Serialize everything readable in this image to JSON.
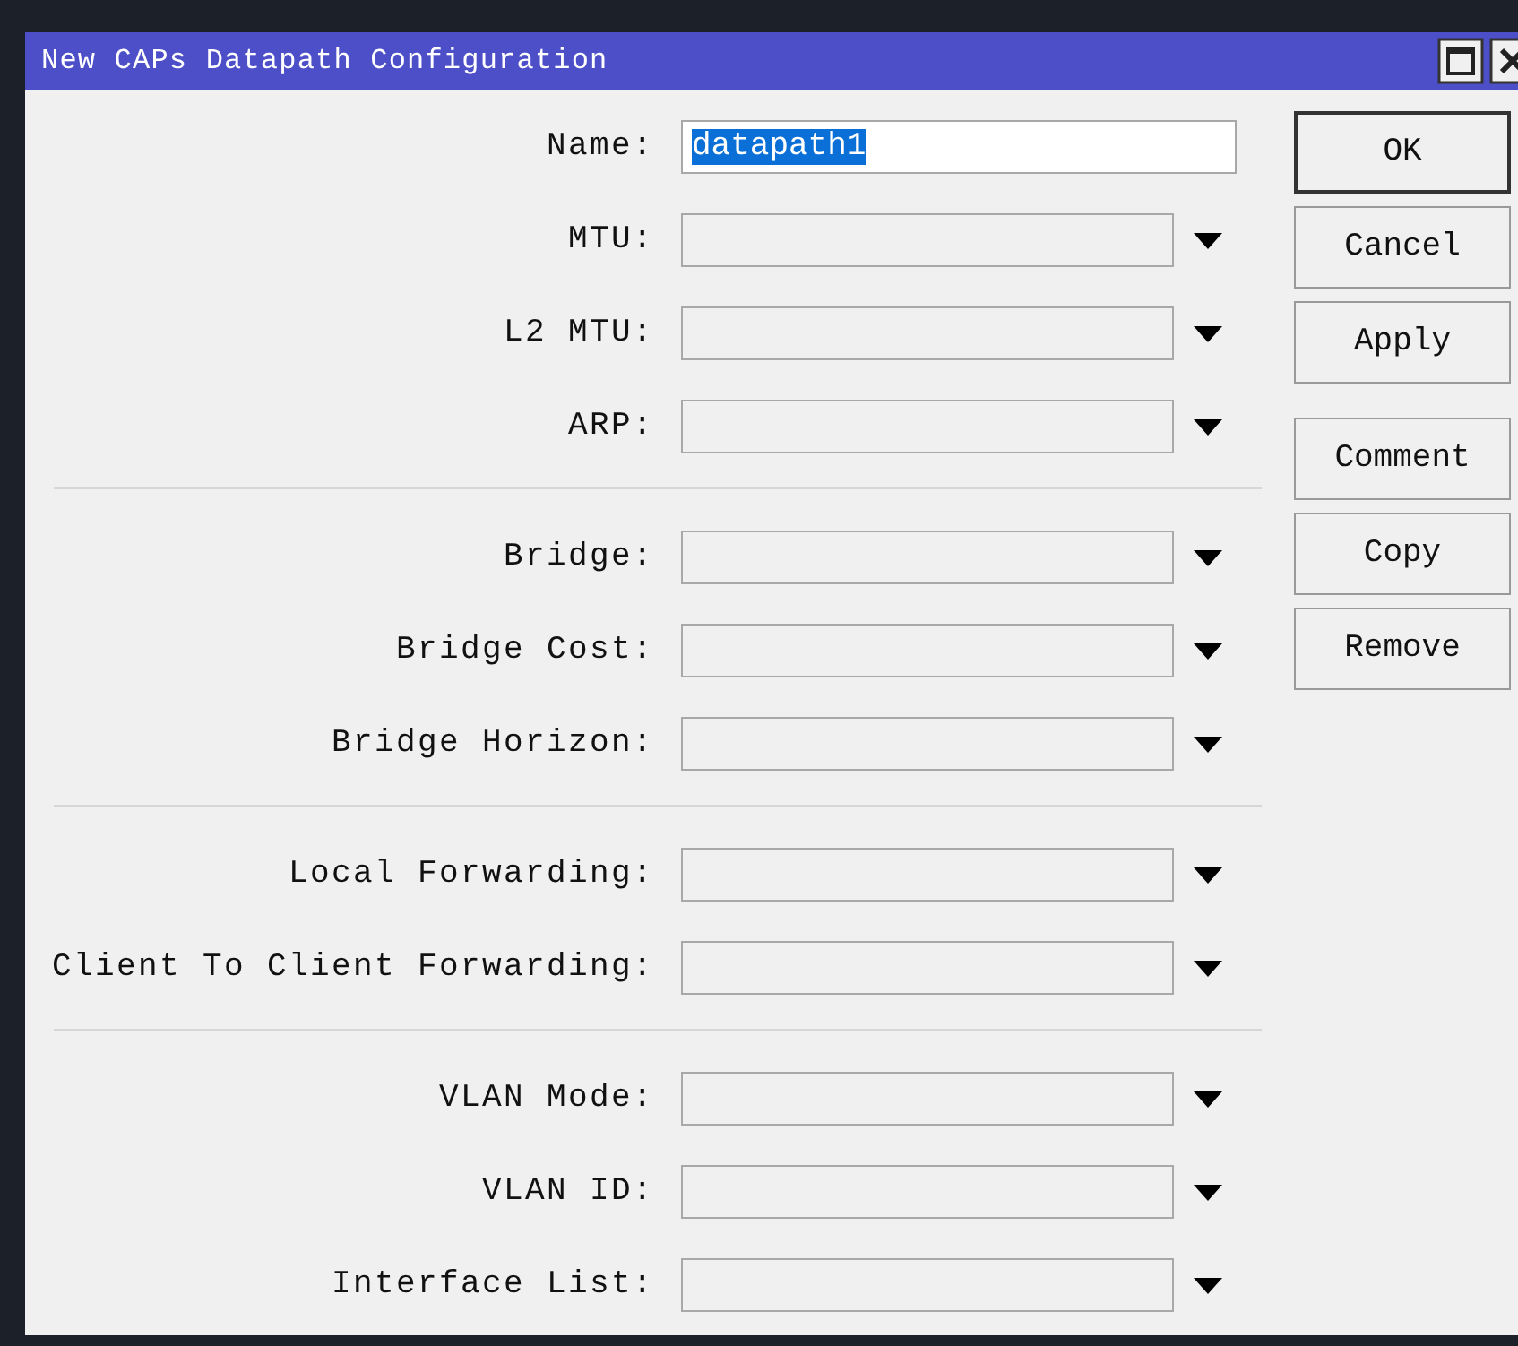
{
  "window": {
    "title": "New CAPs Datapath Configuration"
  },
  "field_groups": [
    [
      {
        "label": "Name:",
        "kind": "text",
        "value": "datapath1",
        "value_highlighted": true
      },
      {
        "label": "MTU:",
        "kind": "dropdown"
      },
      {
        "label": "L2 MTU:",
        "kind": "dropdown"
      },
      {
        "label": "ARP:",
        "kind": "dropdown"
      }
    ],
    [
      {
        "label": "Bridge:",
        "kind": "dropdown"
      },
      {
        "label": "Bridge Cost:",
        "kind": "dropdown"
      },
      {
        "label": "Bridge Horizon:",
        "kind": "dropdown"
      }
    ],
    [
      {
        "label": "Local Forwarding:",
        "kind": "dropdown"
      },
      {
        "label": "Client To Client Forwarding:",
        "kind": "dropdown"
      }
    ],
    [
      {
        "label": "VLAN Mode:",
        "kind": "dropdown"
      },
      {
        "label": "VLAN ID:",
        "kind": "dropdown"
      },
      {
        "label": "Interface List:",
        "kind": "dropdown"
      }
    ]
  ],
  "button_groups": [
    [
      {
        "label": "OK",
        "default": true
      },
      {
        "label": "Cancel",
        "default": false
      },
      {
        "label": "Apply",
        "default": false
      }
    ],
    [
      {
        "label": "Comment",
        "default": false
      },
      {
        "label": "Copy",
        "default": false
      },
      {
        "label": "Remove",
        "default": false
      }
    ]
  ]
}
